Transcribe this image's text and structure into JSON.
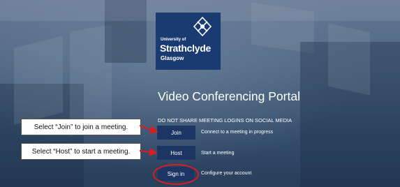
{
  "logo": {
    "line1": "University of",
    "line2": "Strathclyde",
    "line3": "Glasgow"
  },
  "title": "Video Conferencing Portal",
  "warning": "DO NOT SHARE MEETING LOGINS ON SOCIAL MEDIA",
  "actions": [
    {
      "label": "Join",
      "description": "Connect to a meeting in progress"
    },
    {
      "label": "Host",
      "description": "Start a meeting"
    },
    {
      "label": "Sign in",
      "description": "Configure your account"
    }
  ],
  "callouts": {
    "join": "Select “Join” to join a meeting.",
    "host": "Select “Host” to start a meeting."
  },
  "colors": {
    "button_bg": "#1d3565",
    "logo_bg": "#1a3b72",
    "annotation_red": "#d81e1e"
  }
}
